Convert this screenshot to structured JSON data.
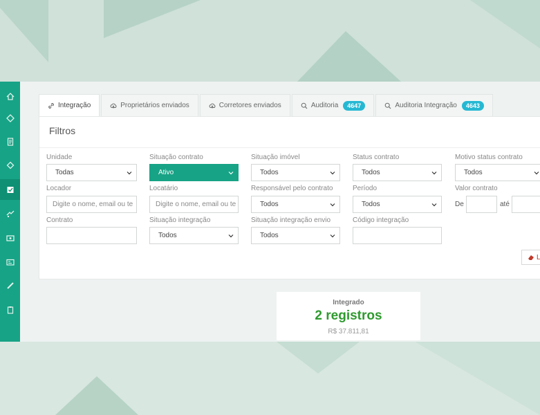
{
  "tabs": [
    {
      "label": "Integração",
      "icon": "link-icon"
    },
    {
      "label": "Proprietários enviados",
      "icon": "cloud-upload-icon"
    },
    {
      "label": "Corretores enviados",
      "icon": "cloud-upload-icon"
    },
    {
      "label": "Auditoria",
      "icon": "search-icon",
      "badge": "4647"
    },
    {
      "label": "Auditoria Integração",
      "icon": "search-icon",
      "badge": "4643"
    }
  ],
  "filters": {
    "title": "Filtros",
    "unidade": {
      "label": "Unidade",
      "value": "Todas"
    },
    "situacao_contrato": {
      "label": "Situação contrato",
      "value": "Ativo"
    },
    "situacao_imovel": {
      "label": "Situação imóvel",
      "value": "Todos"
    },
    "status_contrato": {
      "label": "Status contrato",
      "value": "Todos"
    },
    "motivo_status_contrato": {
      "label": "Motivo status contrato",
      "value": "Todos"
    },
    "locador": {
      "label": "Locador",
      "placeholder": "Digite o nome, email ou te"
    },
    "locatario": {
      "label": "Locatário",
      "placeholder": "Digite o nome, email ou te"
    },
    "responsavel": {
      "label": "Responsável pelo contrato",
      "value": "Todos"
    },
    "periodo": {
      "label": "Período",
      "value": "Todos"
    },
    "valor_contrato": {
      "label": "Valor contrato",
      "de": "De",
      "ate": "até"
    },
    "contrato": {
      "label": "Contrato",
      "value": ""
    },
    "situacao_integracao": {
      "label": "Situação integração",
      "value": "Todos"
    },
    "situacao_integracao_envio": {
      "label": "Situação integração envio",
      "value": "Todos"
    },
    "codigo_integracao": {
      "label": "Código integração",
      "value": ""
    },
    "clear_label": "L"
  },
  "summary": {
    "label": "Integrado",
    "value": "2 registros",
    "money": "R$ 37.811,81"
  },
  "colors": {
    "sidebar": "#17a386",
    "accent": "#17a386",
    "badge": "#26b8d3",
    "success": "#2e9a2e"
  },
  "sidebar": {
    "items": [
      "home-icon",
      "tag-icon",
      "document-icon",
      "diamond-icon",
      "checklist-icon",
      "handshake-icon",
      "money-icon",
      "id-card-icon",
      "ruler-icon",
      "clipboard-icon"
    ]
  }
}
